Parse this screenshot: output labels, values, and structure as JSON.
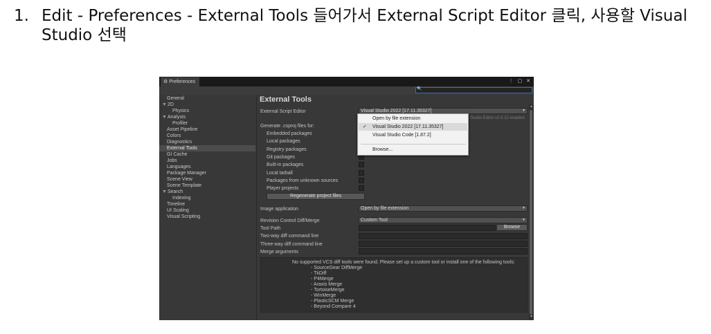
{
  "instruction": {
    "number": "1.",
    "text": "Edit - Preferences - External Tools 들어가서 External Script Editor 클릭, 사용할 Visual Studio 선택"
  },
  "window": {
    "tab_title": "Preferences",
    "controls": "⋮ ▢ ✕"
  },
  "sidebar": {
    "items": [
      {
        "label": "General",
        "indent": 0,
        "caret": ""
      },
      {
        "label": "2D",
        "indent": 0,
        "caret": "▼"
      },
      {
        "label": "Physics",
        "indent": 1,
        "caret": ""
      },
      {
        "label": "Analysis",
        "indent": 0,
        "caret": "▼"
      },
      {
        "label": "Profiler",
        "indent": 1,
        "caret": ""
      },
      {
        "label": "Asset Pipeline",
        "indent": 0,
        "caret": ""
      },
      {
        "label": "Colors",
        "indent": 0,
        "caret": ""
      },
      {
        "label": "Diagnostics",
        "indent": 0,
        "caret": ""
      },
      {
        "label": "External Tools",
        "indent": 0,
        "caret": "",
        "selected": true
      },
      {
        "label": "GI Cache",
        "indent": 0,
        "caret": ""
      },
      {
        "label": "Jobs",
        "indent": 0,
        "caret": ""
      },
      {
        "label": "Languages",
        "indent": 0,
        "caret": ""
      },
      {
        "label": "Package Manager",
        "indent": 0,
        "caret": ""
      },
      {
        "label": "Scene View",
        "indent": 0,
        "caret": ""
      },
      {
        "label": "Scene Template",
        "indent": 0,
        "caret": ""
      },
      {
        "label": "Search",
        "indent": 0,
        "caret": "▼"
      },
      {
        "label": "Indexing",
        "indent": 1,
        "caret": ""
      },
      {
        "label": "Timeline",
        "indent": 0,
        "caret": ""
      },
      {
        "label": "UI Scaling",
        "indent": 0,
        "caret": ""
      },
      {
        "label": "Visual Scripting",
        "indent": 0,
        "caret": ""
      }
    ]
  },
  "main": {
    "title": "External Tools",
    "script_editor": {
      "label": "External Script Editor",
      "value": "Visual Studio 2022 [17.11.35327]",
      "hint": "Studio Editor v2.0.22 enabled"
    },
    "csproj": {
      "label": "Generate .csproj files for:",
      "items": [
        "Embedded packages",
        "Local packages",
        "Registry packages",
        "Git packages",
        "Built-in packages",
        "Local tarball",
        "Packages from unknown sources",
        "Player projects"
      ],
      "regenerate_label": "Regenerate project files"
    },
    "image_application": {
      "label": "Image application",
      "value": "Open by file extension"
    },
    "revision_control": {
      "label": "Revision Control Diff/Merge",
      "value": "Custom Tool"
    },
    "tool_path": {
      "label": "Tool Path",
      "browse_label": "Browse"
    },
    "two_way_label": "Two-way diff command line",
    "three_way_label": "Three-way diff command line",
    "merge_args_label": "Merge arguments",
    "help": {
      "message": "No supported VCS diff tools were found. Please set up a custom tool or install one of the following tools:",
      "tools": [
        "- SourceGear DiffMerge",
        "- TkDiff",
        "- P4Merge",
        "- Araxis Merge",
        "- TortoiseMerge",
        "- WinMerge",
        "- PlasticSCM Merge",
        "- Beyond Compare 4"
      ]
    }
  },
  "dropdown_popup": {
    "items": [
      {
        "label": "Open by file extension",
        "checked": false
      },
      {
        "label": "Visual Studio 2022 [17.11.35327]",
        "checked": true
      },
      {
        "label": "Visual Studio Code [1.87.2]",
        "checked": false
      },
      {
        "label": "Browse...",
        "checked": false
      }
    ],
    "check_glyph": "✓"
  },
  "colors": {
    "window_bg": "#383838",
    "titlebar_bg": "#191919",
    "selected_item": "#4c4c4c",
    "popup_bg": "#f2f2f2",
    "search_border": "#3c6bb0"
  }
}
